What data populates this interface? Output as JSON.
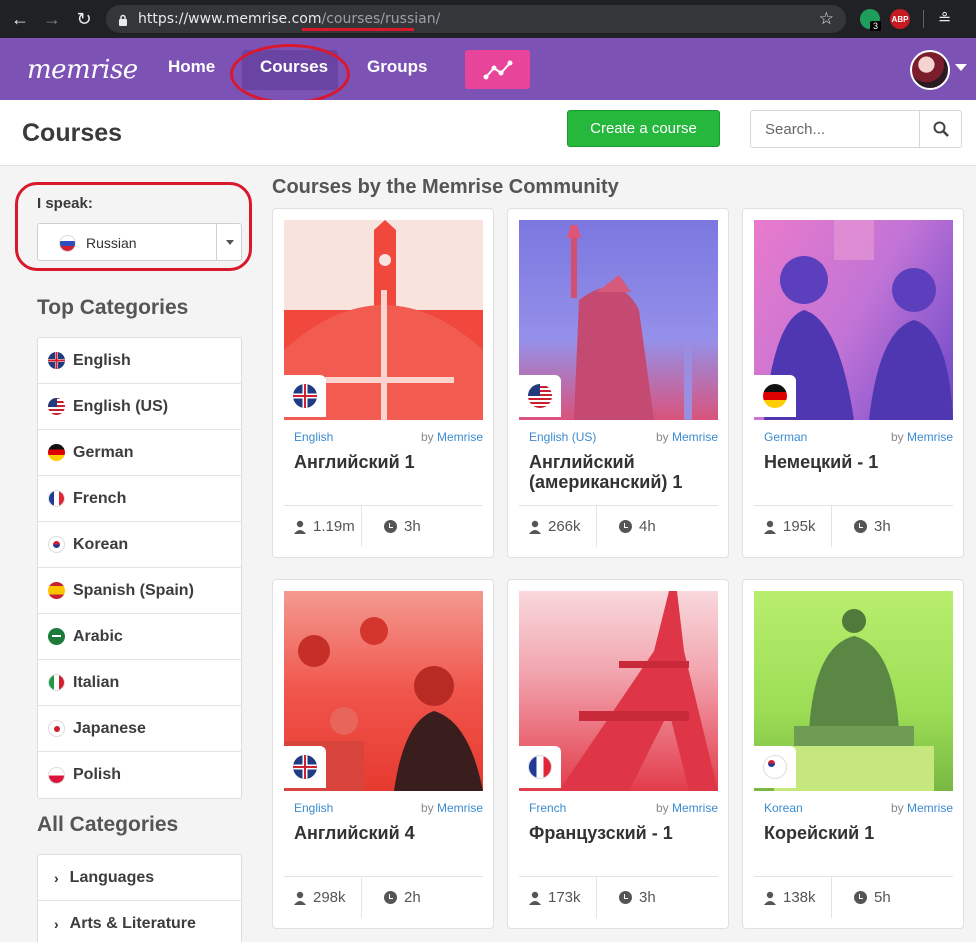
{
  "browser": {
    "url_base": "https://www.memrise.com",
    "url_path": "/courses/russian/",
    "extension_badge": "3",
    "abp_label": "ABP"
  },
  "header": {
    "logo": "memrise",
    "nav": {
      "home": "Home",
      "courses": "Courses",
      "groups": "Groups"
    }
  },
  "page": {
    "title": "Courses",
    "create_label": "Create a course",
    "search_placeholder": "Search..."
  },
  "sidebar": {
    "speak_label": "I speak:",
    "selected_language": "Russian",
    "top_categories_title": "Top Categories",
    "top_categories": [
      {
        "label": "English",
        "flag": "gb"
      },
      {
        "label": "English (US)",
        "flag": "us"
      },
      {
        "label": "German",
        "flag": "de"
      },
      {
        "label": "French",
        "flag": "fr"
      },
      {
        "label": "Korean",
        "flag": "kr"
      },
      {
        "label": "Spanish (Spain)",
        "flag": "es"
      },
      {
        "label": "Arabic",
        "flag": "ar"
      },
      {
        "label": "Italian",
        "flag": "it"
      },
      {
        "label": "Japanese",
        "flag": "jp"
      },
      {
        "label": "Polish",
        "flag": "pl"
      }
    ],
    "all_categories_title": "All Categories",
    "all_categories": [
      "Languages",
      "Arts & Literature"
    ]
  },
  "community": {
    "title": "Courses by the Memrise Community",
    "by_prefix": "by",
    "courses": [
      {
        "language": "English",
        "author": "Memrise",
        "title": "Английский 1",
        "learners": "1.19m",
        "time": "3h",
        "flag": "gb",
        "image": "big-ben-umbrella"
      },
      {
        "language": "English (US)",
        "author": "Memrise",
        "title": "Английский (американский) 1",
        "learners": "266k",
        "time": "4h",
        "flag": "us",
        "image": "statue-of-liberty"
      },
      {
        "language": "German",
        "author": "Memrise",
        "title": "Немецкий - 1",
        "learners": "195k",
        "time": "3h",
        "flag": "de",
        "image": "goethe-schiller-statue"
      },
      {
        "language": "English",
        "author": "Memrise",
        "title": "Английский 4",
        "learners": "298k",
        "time": "2h",
        "flag": "gb",
        "image": "crowd-deckchairs"
      },
      {
        "language": "French",
        "author": "Memrise",
        "title": "Французский - 1",
        "learners": "173k",
        "time": "3h",
        "flag": "fr",
        "image": "eiffel-tower"
      },
      {
        "language": "Korean",
        "author": "Memrise",
        "title": "Корейский 1",
        "learners": "138k",
        "time": "5h",
        "flag": "kr",
        "image": "king-sejong-statue"
      }
    ]
  },
  "colors": {
    "header_purple": "#7c53b5",
    "create_green": "#26b83d",
    "stats_pink": "#e8449a",
    "link_blue": "#3b8bd0",
    "annotation_red": "#d9182d"
  }
}
